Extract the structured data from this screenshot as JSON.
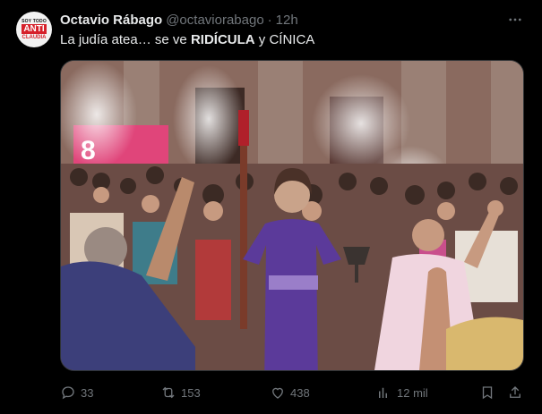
{
  "author": {
    "display_name": "Octavio Rábago",
    "handle": "@octaviorabago",
    "separator": "·",
    "time": "12h",
    "avatar": {
      "line1": "SOY TODO",
      "line2": "ANTI",
      "line3": "CLAUDIA"
    }
  },
  "post": {
    "text_part1": "La judía atea… se ve ",
    "text_bold": "RIDÍCULA",
    "text_part2": " y CÍNICA"
  },
  "media": {
    "banner_text": "8"
  },
  "actions": {
    "reply_count": "33",
    "retweet_count": "153",
    "like_count": "438",
    "views_count": "12 mil"
  },
  "icons": {
    "more": "more-horizontal-icon",
    "reply": "reply-icon",
    "retweet": "retweet-icon",
    "like": "heart-icon",
    "views": "views-bar-chart-icon",
    "bookmark": "bookmark-icon",
    "share": "share-icon"
  },
  "colors": {
    "background": "#000000",
    "text_primary": "#e7e9ea",
    "text_secondary": "#71767b",
    "border": "#2f3336",
    "dress_purple": "#5b3a9a",
    "avatar_red": "#d6202a"
  }
}
